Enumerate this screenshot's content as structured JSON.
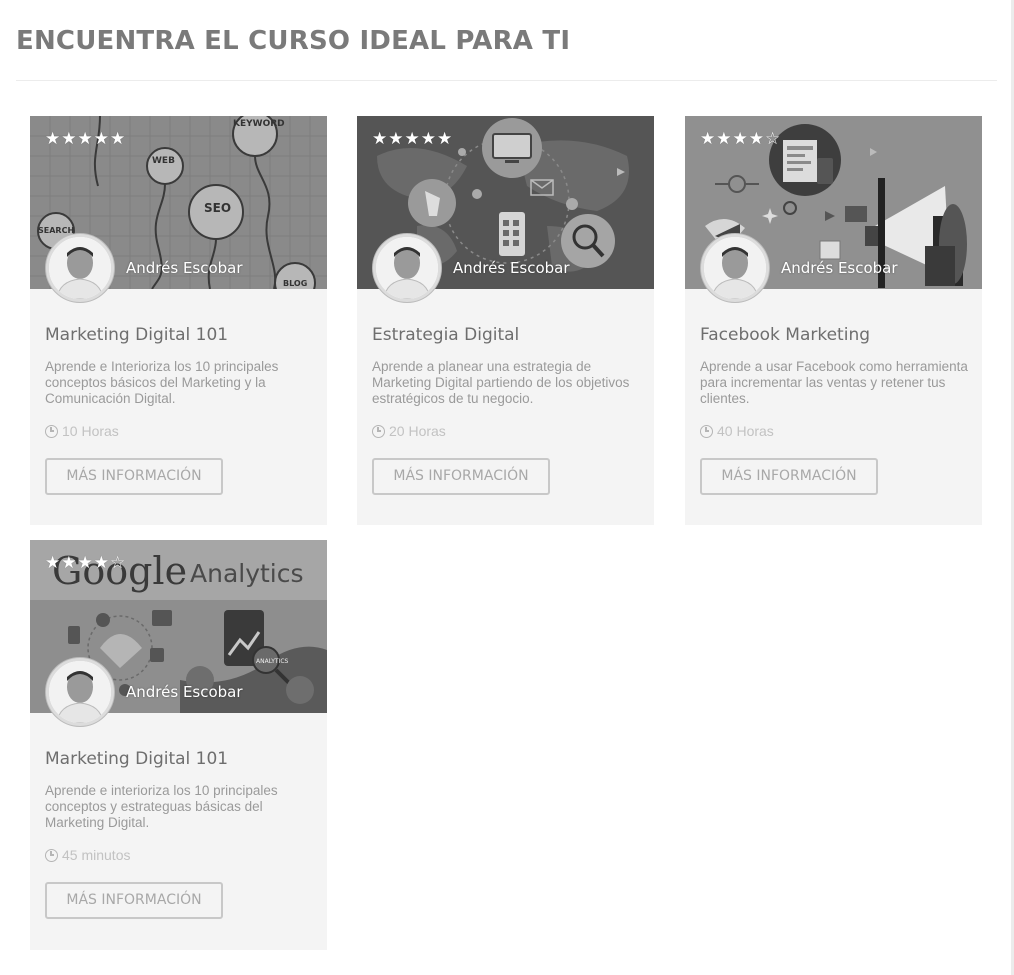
{
  "page": {
    "title": "ENCUENTRA EL CURSO IDEAL PARA TI"
  },
  "courses": [
    {
      "stars": "★★★★★",
      "rating": 5,
      "instructor": "Andrés Escobar",
      "title": "Marketing Digital 101",
      "description": "Aprende e Interioriza los 10 principales conceptos básicos del Marketing y la Comunicación Digital.",
      "duration": "10 Horas",
      "button": "MÁS INFORMACIÓN",
      "thumb_text": {
        "t1": "KEYWORD",
        "t2": "WEB",
        "t3": "SEO",
        "t4": "SEARCH",
        "t5": "BLOG"
      }
    },
    {
      "stars": "★★★★★",
      "rating": 5,
      "instructor": "Andrés Escobar",
      "title": "Estrategia Digital",
      "description": "Aprende a planear una estrategia de Marketing Digital partiendo de los objetivos estratégicos de tu negocio.",
      "duration": "20 Horas",
      "button": "MÁS INFORMACIÓN"
    },
    {
      "stars": "★★★★☆",
      "rating": 4,
      "instructor": "Andrés Escobar",
      "title": "Facebook Marketing",
      "description": "Aprende a usar Facebook como herramienta para incrementar las ventas y retener tus clientes.",
      "duration": "40 Horas",
      "button": "MÁS INFORMACIÓN"
    },
    {
      "stars": "★★★★☆",
      "rating": 4,
      "instructor": "Andrés Escobar",
      "title": "Marketing Digital 101",
      "description": "Aprende e interioriza los 10 principales conceptos y estrateguas básicas del Marketing Digital.",
      "duration": "45 minutos",
      "button": "MÁS INFORMACIÓN",
      "thumb_text": {
        "t1": "Google",
        "t2": "Analytics",
        "t3": "ANALYTICS"
      }
    }
  ]
}
